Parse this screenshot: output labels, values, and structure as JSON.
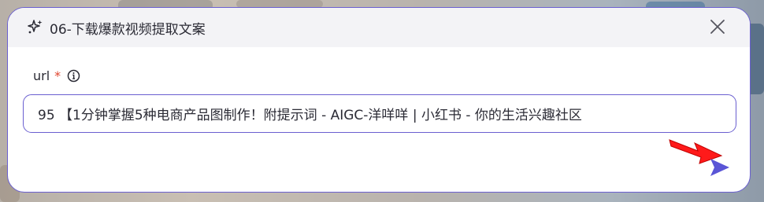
{
  "dialog": {
    "title": "06-下载爆款视频提取文案",
    "title_icon": "sparkle-icon",
    "close_icon": "close-icon"
  },
  "form": {
    "field_label": "url",
    "required_mark": "*",
    "info_icon": "info-icon",
    "url_value": "95 【1分钟掌握5种电商产品图制作！附提示词 - AIGC-洋咩咩 | 小红书 - 你的生活兴趣社区"
  },
  "actions": {
    "send_icon": "send-icon"
  },
  "annotation": {
    "pointer_arrow": "red-arrow-icon"
  },
  "colors": {
    "accent": "#6a5fd0",
    "send": "#5a55d6",
    "required": "#e0452f",
    "header_bg": "#f3f3f6",
    "annotation_arrow": "#ff1a1a"
  }
}
